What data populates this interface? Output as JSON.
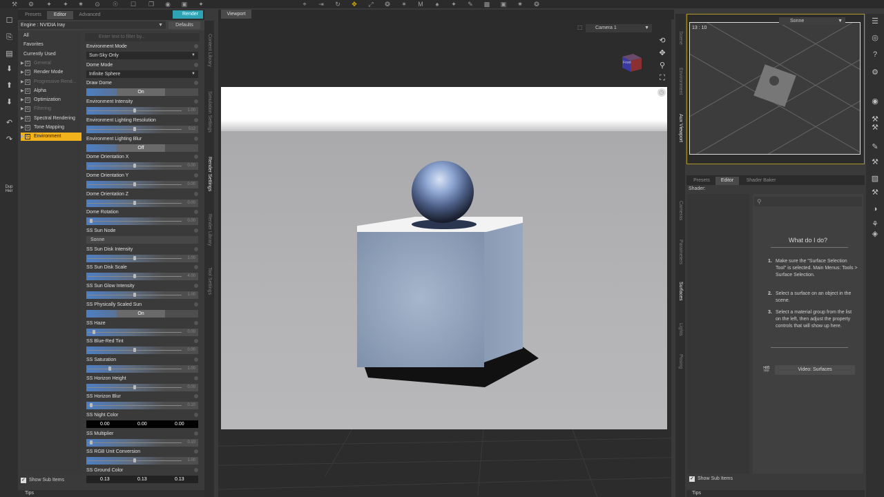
{
  "top_tools": [
    "⚒",
    "⚙",
    "✦",
    "✦",
    "✷",
    "⊙",
    "☉",
    "☐",
    "❐",
    "◉",
    "▣",
    "✦",
    "⌖",
    "⇥",
    "↻",
    "✥",
    "⤢",
    "❂",
    "✶",
    "M",
    "♠",
    "✦",
    "✎",
    "▩",
    "▣",
    "✷",
    "❂"
  ],
  "left_tools": {
    "icons": [
      "☐",
      "⎘",
      "▤",
      "⬇",
      "⬆",
      "⬇",
      "↶",
      "↷"
    ],
    "dup": "Dup",
    "hier": "Hier"
  },
  "render_panel": {
    "tabs": [
      "Presets",
      "Editor",
      "Advanced"
    ],
    "active_tab": "Editor",
    "render_button": "Render",
    "engine_label": "Engine :",
    "engine_value": "NVIDIA Iray",
    "defaults_button": "Defaults",
    "search_placeholder": "Enter text to filter by...",
    "categories": [
      {
        "label": "All",
        "group": false,
        "dim": false
      },
      {
        "label": "Favorites",
        "group": false,
        "dim": false
      },
      {
        "label": "Currently Used",
        "group": false,
        "dim": false
      },
      {
        "label": "General",
        "group": true,
        "dim": true
      },
      {
        "label": "Render Mode",
        "group": true,
        "dim": false
      },
      {
        "label": "Progressive Rend...",
        "group": true,
        "dim": true
      },
      {
        "label": "Alpha",
        "group": true,
        "dim": false
      },
      {
        "label": "Optimization",
        "group": true,
        "dim": false
      },
      {
        "label": "Filtering",
        "group": true,
        "dim": true
      },
      {
        "label": "Spectral Rendering",
        "group": true,
        "dim": false
      },
      {
        "label": "Tone Mapping",
        "group": true,
        "dim": false
      },
      {
        "label": "Environment",
        "group": true,
        "dim": false,
        "selected": true
      }
    ],
    "params": [
      {
        "label": "Environment Mode",
        "type": "select",
        "value": "Sun-Sky Only"
      },
      {
        "label": "Dome Mode",
        "type": "select",
        "value": "Infinite Sphere"
      },
      {
        "label": "Draw Dome",
        "type": "toggle",
        "value": "On"
      },
      {
        "label": "Environment Intensity",
        "type": "slider",
        "value": "1.00",
        "level": 0.5
      },
      {
        "label": "Environment Lighting Resolution",
        "type": "slider",
        "value": "512",
        "level": 0.5
      },
      {
        "label": "Environment Lighting Blur",
        "type": "toggle",
        "value": "Off"
      },
      {
        "label": "Dome Orientation X",
        "type": "slider",
        "value": "0.00",
        "level": 0.5
      },
      {
        "label": "Dome Orientation Y",
        "type": "slider",
        "value": "0.00",
        "level": 0.5
      },
      {
        "label": "Dome Orientation Z",
        "type": "slider",
        "value": "0.00",
        "level": 0.5
      },
      {
        "label": "Dome Rotation",
        "type": "slider",
        "value": "0.00",
        "level": 0.02
      },
      {
        "label": "SS Sun Node",
        "type": "node",
        "value": "Sonne"
      },
      {
        "label": "SS Sun Disk Intensity",
        "type": "slider",
        "value": "1.00",
        "level": 0.5
      },
      {
        "label": "SS Sun Disk Scale",
        "type": "slider",
        "value": "4.00",
        "level": 0.5
      },
      {
        "label": "SS Sun Glow Intensity",
        "type": "slider",
        "value": "1.00",
        "level": 0.5
      },
      {
        "label": "SS Physically Scaled Sun",
        "type": "toggle",
        "value": "On"
      },
      {
        "label": "SS Haze",
        "type": "slider",
        "value": "0.00",
        "level": 0.05
      },
      {
        "label": "SS Blue-Red Tint",
        "type": "slider",
        "value": "0.00",
        "level": 0.5
      },
      {
        "label": "SS Saturation",
        "type": "slider",
        "value": "1.00",
        "level": 0.23
      },
      {
        "label": "SS Horizon Height",
        "type": "slider",
        "value": "0.00",
        "level": 0.5
      },
      {
        "label": "SS Horizon Blur",
        "type": "slider",
        "value": "0.10",
        "level": 0.02
      },
      {
        "label": "SS Night Color",
        "type": "color",
        "values": [
          "0.00",
          "0.00",
          "0.00"
        ]
      },
      {
        "label": "SS Multiplier",
        "type": "slider",
        "value": "0.10",
        "level": 0.02
      },
      {
        "label": "SS RGB Unit Conversion",
        "type": "slider",
        "value": "1.00",
        "level": 0.5
      },
      {
        "label": "SS Ground Color",
        "type": "color_gray",
        "values": [
          "0.13",
          "0.13",
          "0.13"
        ]
      }
    ],
    "show_sub_items": "Show Sub Items",
    "tips": "Tips"
  },
  "left_vtabs": [
    "Content Library",
    "Simulation Settings",
    "Render Settings",
    "Render Library",
    "Tool Settings"
  ],
  "left_vtabs_active": "Render Settings",
  "viewport": {
    "tab": "Viewport",
    "camera": "Camera 1",
    "nav_cube_label": "Front"
  },
  "aux_viewport": {
    "time": "13 : 10",
    "sun": "Sonne"
  },
  "right_vtabs": [
    "Scene",
    "Environment",
    "Aux Viewport",
    "Cameras",
    "Parameters",
    "Surfaces",
    "Lights",
    "Posing"
  ],
  "right_vtabs_active_top": "Aux Viewport",
  "right_vtabs_active_bottom": "Surfaces",
  "surfaces": {
    "tabs": [
      "Presets",
      "Editor",
      "Shader Baker"
    ],
    "active_tab": "Editor",
    "shader_label": "Shader:",
    "what_title": "What do I do?",
    "steps": [
      {
        "num": "1.",
        "text": "Make sure the \"Surface Selection Tool\" is selected. Main Menus: Tools > Surface Selection."
      },
      {
        "num": "2.",
        "text": "Select a surface on an object in the scene."
      },
      {
        "num": "3.",
        "text": "Select a material group from the list on the left, then adjust the property controls that will show up here."
      }
    ],
    "video_button": "Video: Surfaces",
    "show_sub_items": "Show Sub Items",
    "tips": "Tips"
  },
  "right_tools": [
    "☰",
    "◎",
    "?",
    "⚙",
    "◉",
    "⚒",
    "⚒",
    "✎",
    "⚒",
    "▨",
    "⚒",
    "◑",
    "⚘",
    "◈"
  ]
}
